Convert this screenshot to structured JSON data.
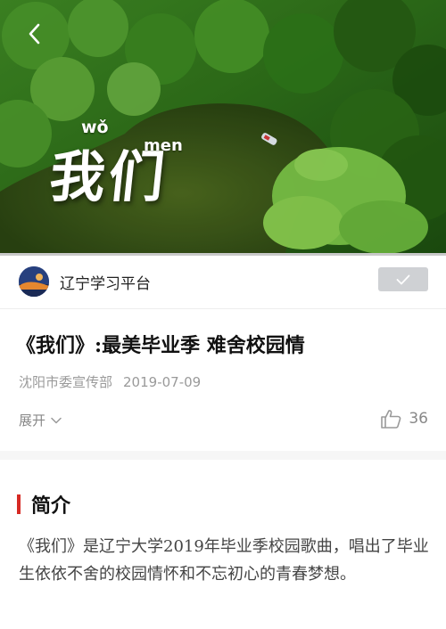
{
  "video": {
    "pinyin_wo": "wǒ",
    "pinyin_men": "men",
    "title_chars": "我们",
    "progress_fraction": 0.0
  },
  "channel": {
    "name": "辽宁学习平台"
  },
  "article": {
    "title": "《我们》:最美毕业季 难舍校园情",
    "source": "沈阳市委宣传部",
    "date": "2019-07-09",
    "expand_label": "展开",
    "like_count": "36"
  },
  "intro": {
    "heading": "简介",
    "text": "《我们》是辽宁大学2019年毕业季校园歌曲，唱出了毕业生依依不舍的校园情怀和不忘初心的青春梦想。"
  },
  "colors": {
    "accent": "#d62a24",
    "follow_bg": "#cfd1d4"
  },
  "icons": {
    "back": "chevron-left-icon",
    "follow": "checkmark-icon",
    "expand": "chevron-down-icon",
    "like": "thumbs-up-icon"
  }
}
